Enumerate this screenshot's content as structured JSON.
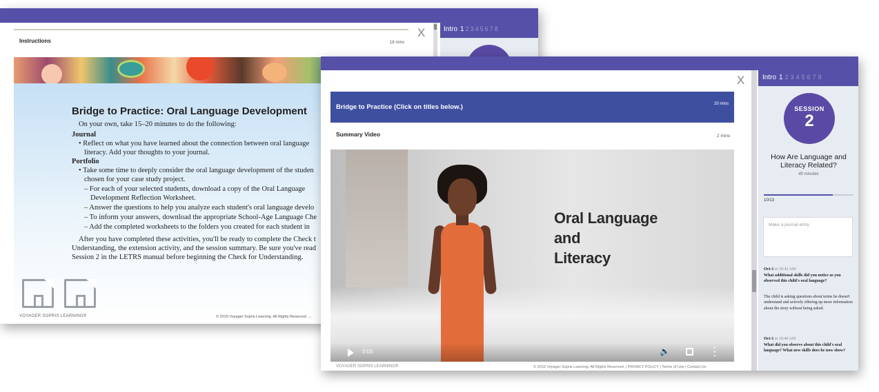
{
  "back_window": {
    "section_title": "Instructions",
    "section_mins": "18 mins",
    "close": "X",
    "tabs": {
      "intro": "Intro",
      "active": "1",
      "others": [
        "2",
        "3",
        "4",
        "5",
        "6",
        "7",
        "8"
      ]
    },
    "doc": {
      "title": "Bridge to Practice: Oral Language Development",
      "intro": "On your own, take 15–20 minutes to do the following:",
      "journal_head": "Journal",
      "journal_line1": "• Reflect on what you have learned about the connection between oral language",
      "journal_line2": "literacy. Add your thoughts to your journal.",
      "portfolio_head": "Portfolio",
      "portfolio_line1": "• Take some time to deeply consider the oral language development of the studen",
      "portfolio_line2": "chosen for your case study project.",
      "step1_a": "– For each of your selected students, download a copy of the Oral Language",
      "step1_b": "Development Reflection Worksheet.",
      "step2": "– Answer the questions to help you analyze each student's oral language develo",
      "step3": "– To inform your answers, download the appropriate School-Age Language Che",
      "step4": "– Add the completed worksheets to the folders you created for each student in",
      "after1": "After you have completed these activities, you'll be ready to complete the Check t",
      "after2": "Understanding, the extension activity, and the session summary. Be sure you've read",
      "after3": "Session 2 in the LETRS manual before beginning the Check for Understanding."
    },
    "logo_text": "VOYAGER SOPRIS LEARNING®",
    "copyright": "© 2019 Voyager Sopris Learning. All Rights Reserved. ..."
  },
  "front_window": {
    "close": "X",
    "section_bar": {
      "title": "Bridge to Practice (Click on titles below.)",
      "mins": "20 mins"
    },
    "video_title": "Summary Video",
    "video_mins": "2 mins",
    "video": {
      "overlay_line1": "Oral Language",
      "overlay_line2": "and",
      "overlay_line3": "Literacy",
      "time": "0:00"
    },
    "footer_logo": "VOYAGER SOPRIS LEARNING®",
    "footer_copy": "© 2019 Voyager Sopris Learning. All Rights Reserved. | PRIVACY POLICY | Terms of Use | Contact Us"
  },
  "sidebar": {
    "tabs": {
      "intro": "Intro",
      "active": "1",
      "others": [
        "2",
        "3",
        "4",
        "5",
        "6",
        "7",
        "8"
      ]
    },
    "session_label": "SESSION",
    "session_number": "2",
    "session_title_line1": "How Are Language and",
    "session_title_line2": "Literacy Related?",
    "session_minutes": "40 minutes",
    "progress_fraction": 0.77,
    "progress_count": "10/13",
    "journal_placeholder": "Make a journal entry",
    "entries": [
      {
        "date": "Oct-1",
        "time": "at 10:42 AM",
        "question": "What additional skills did you notice as you observed this child's oral language?",
        "answer": "The child is asking questions about terms he doesn't understand and actively offering up more information about the story without being asked."
      },
      {
        "date": "Oct-1",
        "time": "at 10:40 AM",
        "question": "What did you observe about this child's oral language? What new skills does he now show?",
        "answer": ""
      }
    ]
  },
  "colors": {
    "header_purple": "#5650a8",
    "section_blue": "#3f4fa0",
    "session_circle": "#5a4aa5",
    "panel_bg": "#e7ecf2"
  }
}
